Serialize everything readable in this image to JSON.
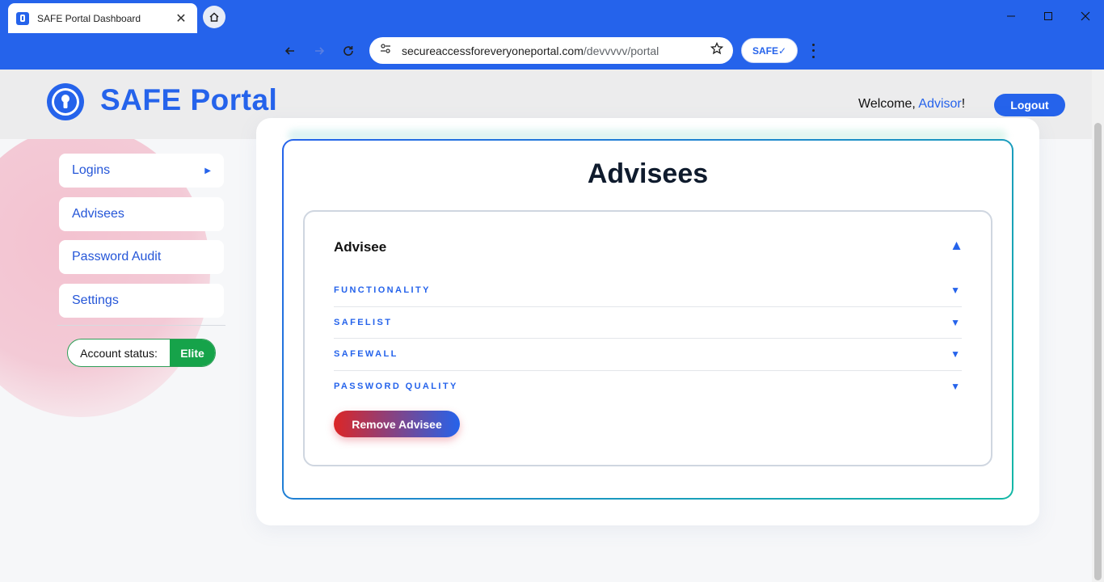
{
  "browser": {
    "tab_title": "SAFE Portal Dashboard",
    "url_domain": "secureaccessforeveryoneportal.com",
    "url_path": "/devvvvv/portal",
    "extension_label": "SAFE✓",
    "accent_color": "#2563eb"
  },
  "header": {
    "brand": "SAFE Portal",
    "welcome_prefix": "Welcome, ",
    "user_name": "Advisor",
    "welcome_suffix": "!",
    "logout_label": "Logout"
  },
  "sidebar": {
    "items": [
      {
        "label": "Logins",
        "has_arrow": true
      },
      {
        "label": "Advisees",
        "active": true
      },
      {
        "label": "Password Audit"
      },
      {
        "label": "Settings"
      }
    ],
    "account_status_label": "Account status:",
    "account_status_value": "Elite",
    "status_color": "#16a34a"
  },
  "main": {
    "title": "Advisees",
    "advisee": {
      "name": "Advisee",
      "sections": [
        {
          "label": "FUNCTIONALITY"
        },
        {
          "label": "SAFELIST"
        },
        {
          "label": "SAFEWALL"
        },
        {
          "label": "PASSWORD QUALITY"
        }
      ],
      "remove_label": "Remove Advisee"
    }
  },
  "icons": {
    "expanded": "▲",
    "collapsed": "▼",
    "submenu": "▶"
  }
}
